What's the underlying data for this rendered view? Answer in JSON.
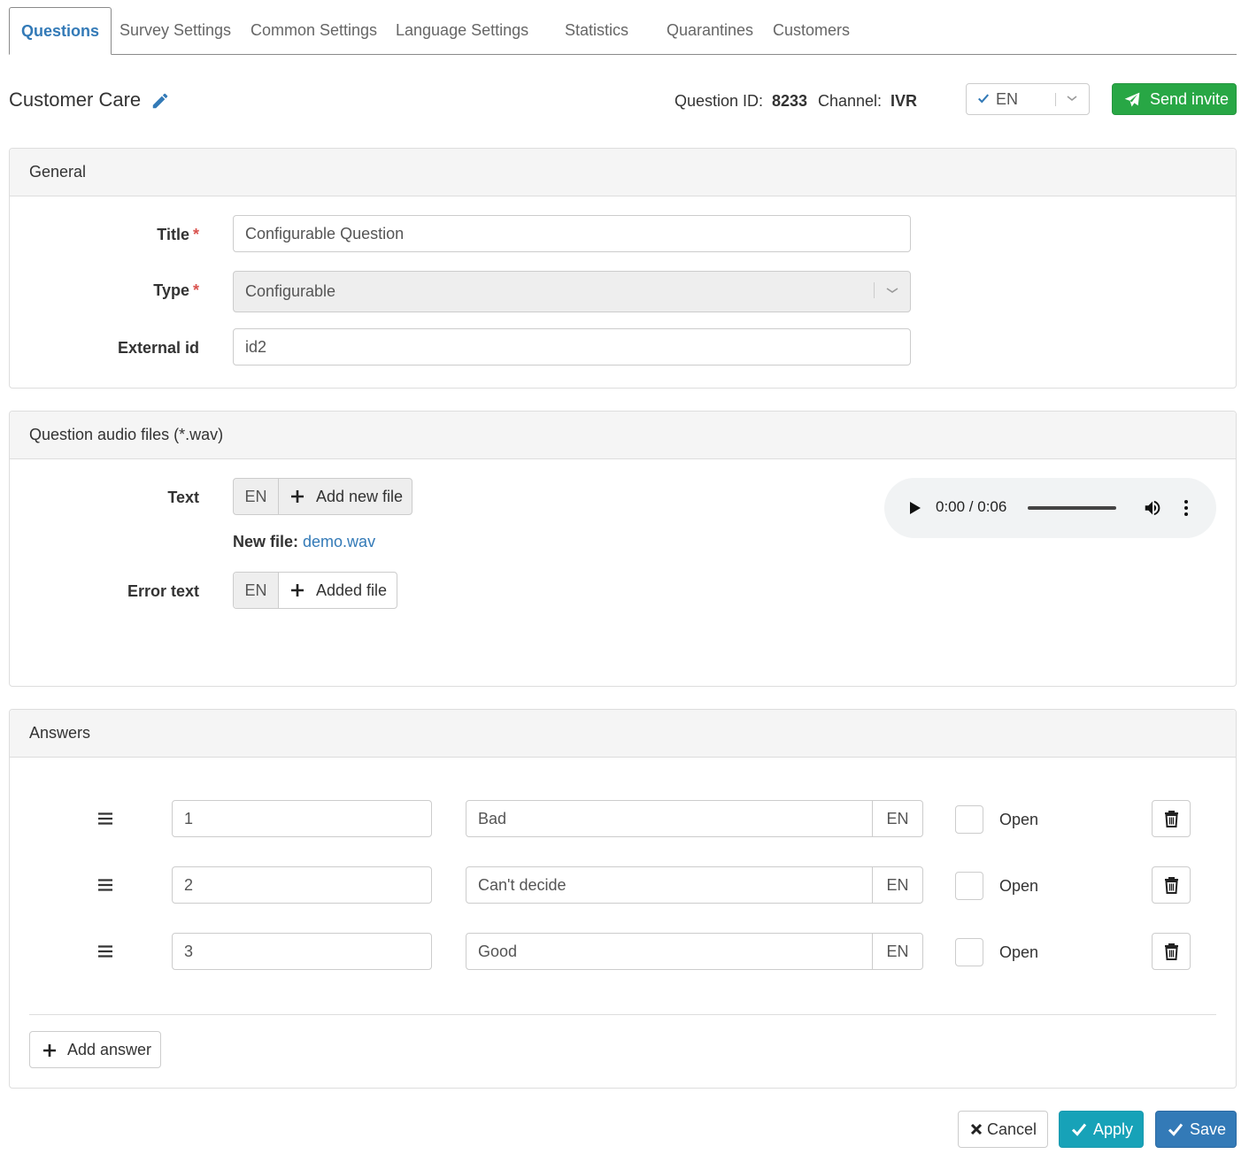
{
  "tabs": [
    {
      "label": "Questions",
      "active": true
    },
    {
      "label": "Survey Settings"
    },
    {
      "label": "Common Settings"
    },
    {
      "label": "Language Settings"
    },
    {
      "label": "Statistics"
    },
    {
      "label": "Quarantines"
    },
    {
      "label": "Customers"
    }
  ],
  "header": {
    "title": "Customer Care",
    "question_id_label": "Question ID:",
    "question_id": "8233",
    "channel_label": "Channel:",
    "channel": "IVR",
    "language": "EN",
    "send_invite": "Send invite"
  },
  "general": {
    "heading": "General",
    "title_label": "Title",
    "title_value": "Configurable Question",
    "type_label": "Type",
    "type_value": "Configurable",
    "external_id_label": "External id",
    "external_id_value": "id2",
    "required_mark": "*"
  },
  "audio": {
    "heading": "Question audio files (*.wav)",
    "text_label": "Text",
    "text_lang": "EN",
    "text_button": "Add new file",
    "new_file_label": "New file:",
    "new_file_name": "demo.wav",
    "error_label": "Error text",
    "error_lang": "EN",
    "error_button": "Added file",
    "player_time": "0:00 / 0:06"
  },
  "answers": {
    "heading": "Answers",
    "items": [
      {
        "value": "1",
        "text": "Bad",
        "lang": "EN",
        "open_label": "Open",
        "open_checked": false
      },
      {
        "value": "2",
        "text": "Can't decide",
        "lang": "EN",
        "open_label": "Open",
        "open_checked": false
      },
      {
        "value": "3",
        "text": "Good",
        "lang": "EN",
        "open_label": "Open",
        "open_checked": false
      }
    ],
    "add_label": "Add answer"
  },
  "footer": {
    "cancel": "Cancel",
    "apply": "Apply",
    "save": "Save"
  },
  "colors": {
    "link": "#337ab7",
    "success": "#28a745",
    "info": "#17a2b8",
    "primary": "#337ab7",
    "required": "#d9534f"
  }
}
